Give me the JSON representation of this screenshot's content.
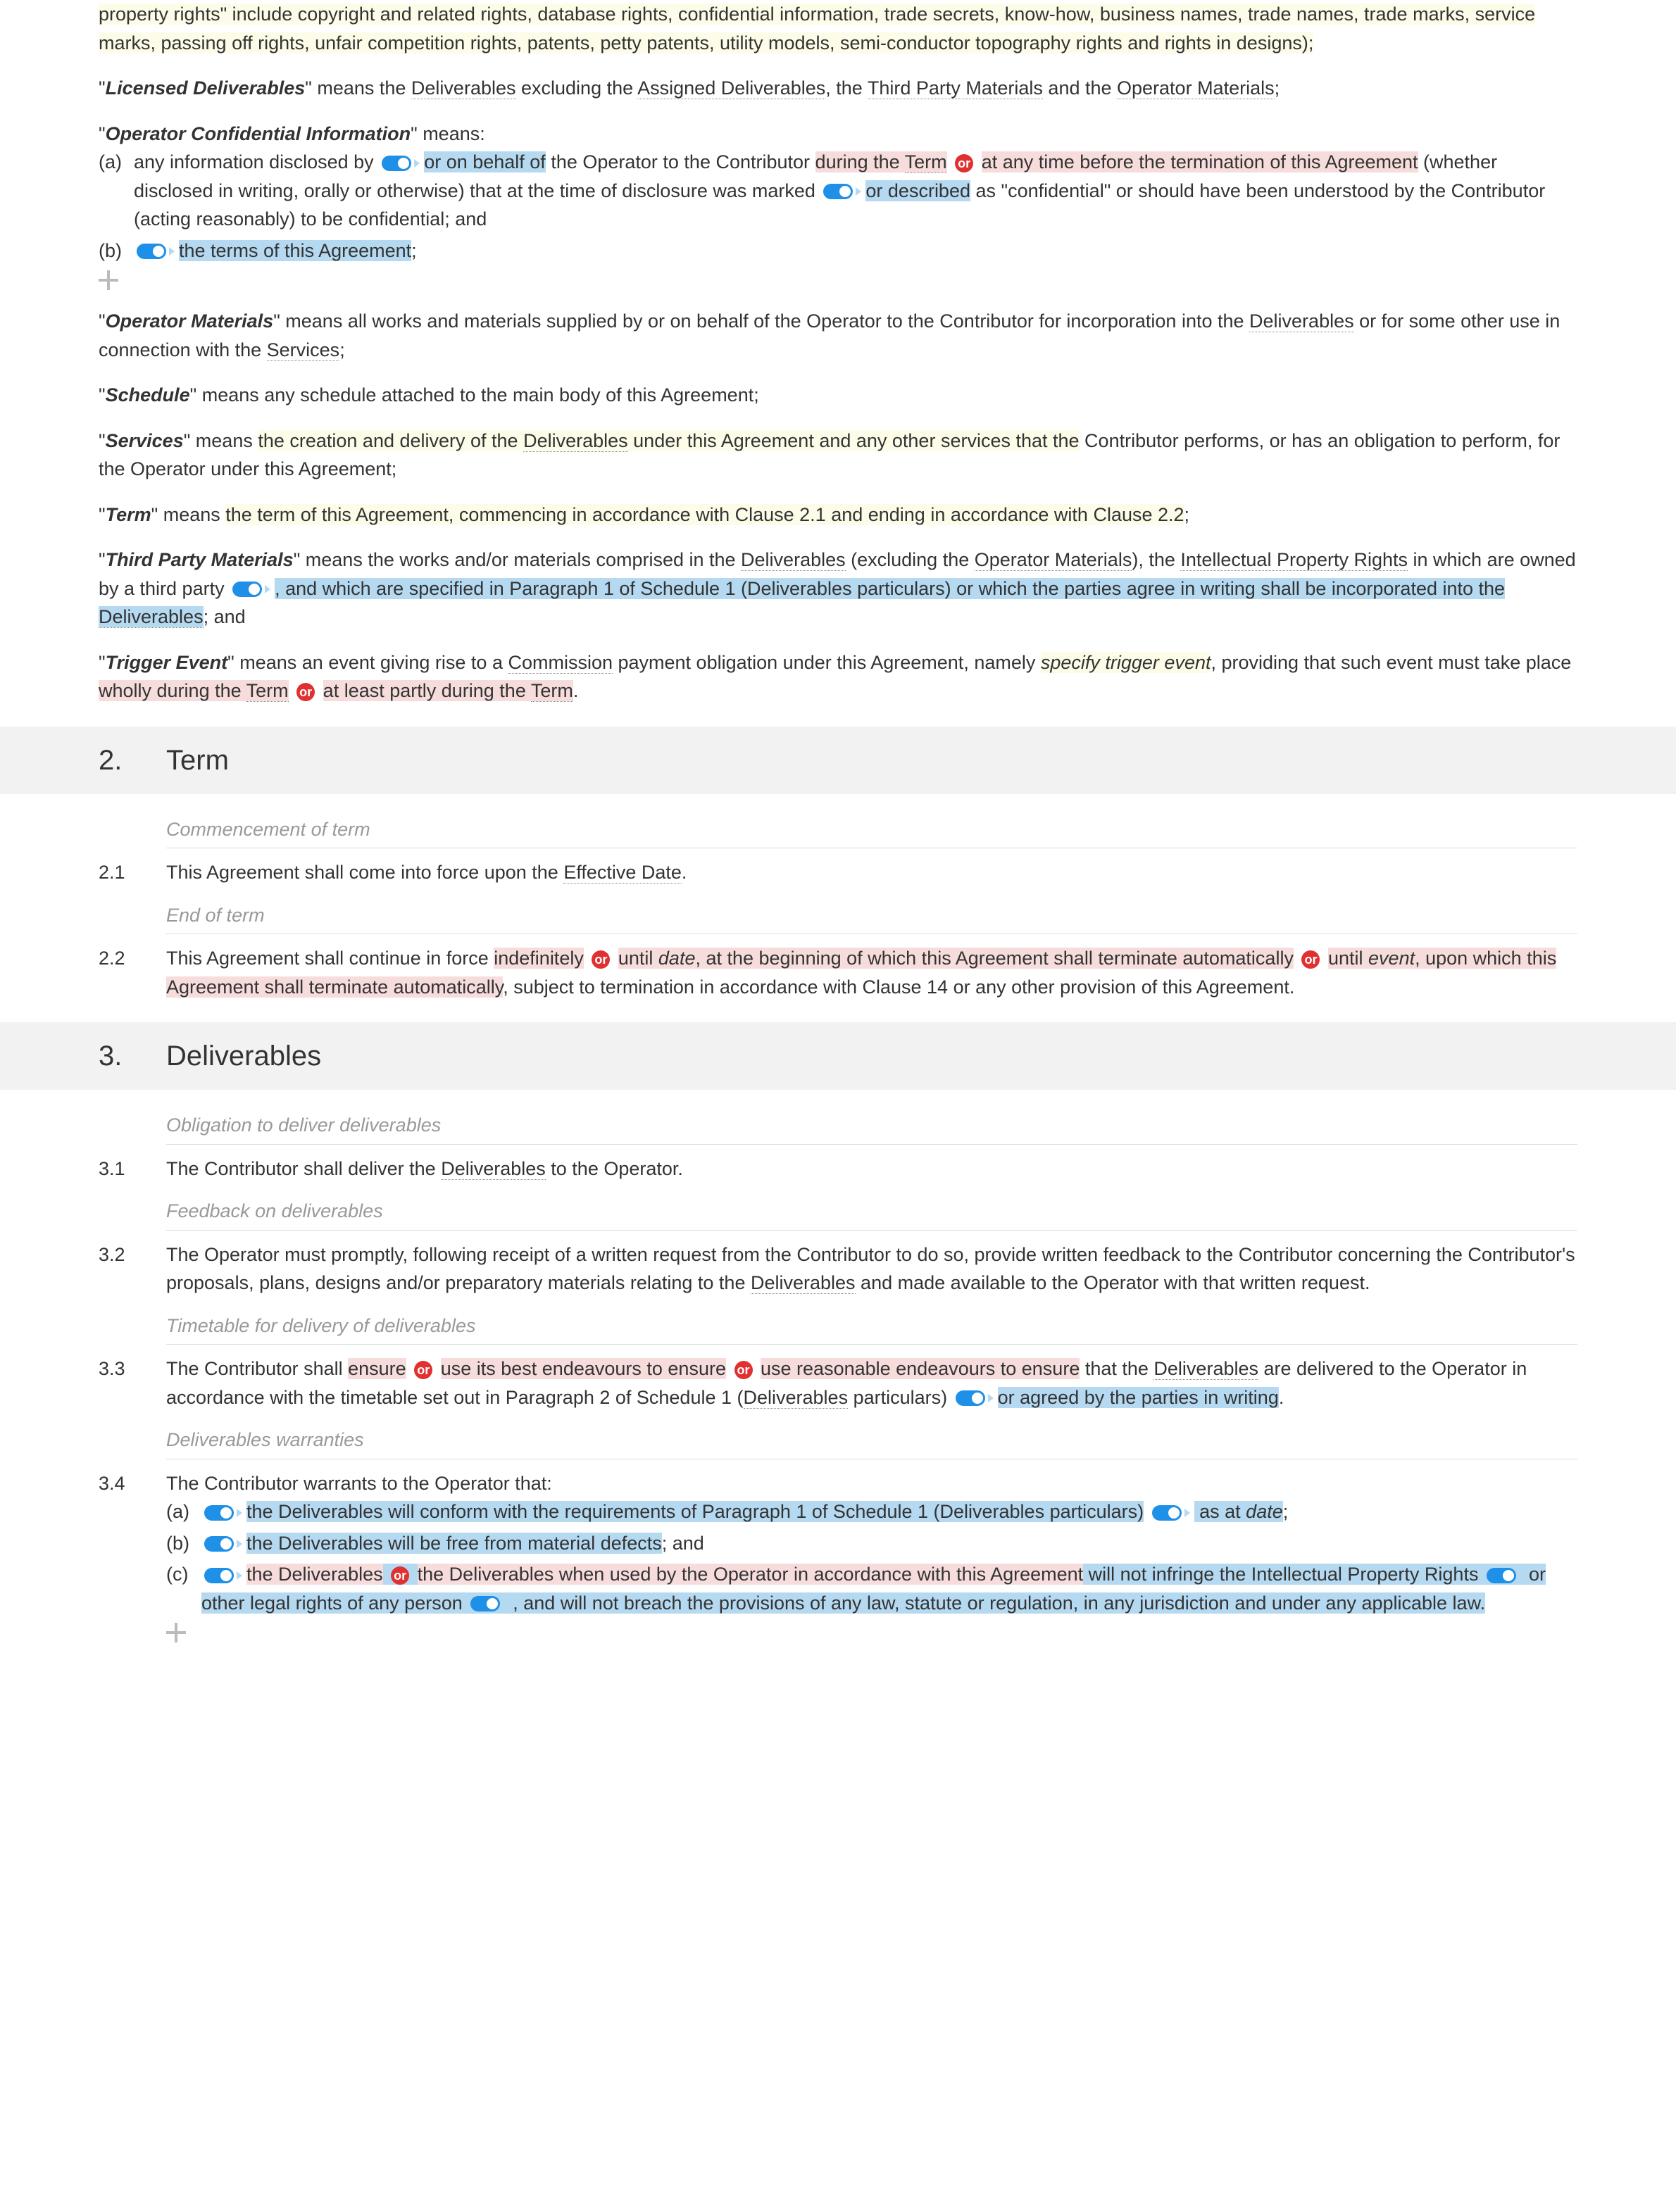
{
  "intro_fragment": "property rights\" include copyright and related rights, database rights, confidential information, trade secrets, know-how, business names, trade names, trade marks, service marks, passing off rights, unfair competition rights, patents, petty patents, utility models, semi-conductor topography rights and rights in designs);",
  "defs": {
    "licensed": {
      "term": "Licensed Deliverables",
      "t1": "\" means the ",
      "d1": "Deliverables",
      "t2": " excluding the ",
      "d2": "Assigned Deliverables",
      "t3": ", the ",
      "d3": "Third Party Materials",
      "t4": " and the ",
      "d4": "Operator Materials",
      "t5": ";"
    },
    "oci": {
      "term": "Operator Confidential Information",
      "means": "\" means:",
      "a_label": "(a)",
      "a1": "any information disclosed by ",
      "a2": "or on behalf of",
      "a3": " the Operator to the Contributor ",
      "a4": "during the ",
      "a4d": "Term",
      "or": "or",
      "a5": "at any time before the termination of this Agreement",
      "a6": " (whether disclosed in writing, orally or otherwise) that at the time of disclosure was marked ",
      "a7": "or described",
      "a8": " as \"confidential\" or should have been understood by the Contributor (acting reasonably) to be confidential; and",
      "b_label": "(b)",
      "b1": "the terms of this Agreement",
      "b2": ";"
    },
    "om": {
      "term": "Operator Materials",
      "t1": "\" means all works and materials supplied by or on behalf of the Operator to the Contributor for incorporation into the ",
      "d1": "Deliverables",
      "t2": " or for some other use in connection with the ",
      "d2": "Services",
      "t3": ";"
    },
    "schedule": {
      "term": "Schedule",
      "body": "\" means any schedule attached to the main body of this Agreement;"
    },
    "services": {
      "term": "Services",
      "t1": "\" means ",
      "t2": "the creation and delivery of the ",
      "d1": "Deliverables",
      "t3": " under this Agreement and any other services that the",
      "t4": " Contributor performs, or has an obligation to perform, for the Operator under this Agreement;"
    },
    "term": {
      "term": "Term",
      "t1": "\" means ",
      "t2": "the term of this Agreement, commencing in accordance with Clause 2.1 and ending in accordance with Clause 2.2",
      "t3": ";"
    },
    "tpm": {
      "term": "Third Party Materials",
      "t1": "\" means the works and/or materials comprised in the ",
      "d1": "Deliverables",
      "t2": " (excluding the ",
      "d2": "Operator Materials",
      "t3": "), the ",
      "d3": "Intellectual Property Rights",
      "t4": " in which are owned by a third party ",
      "t5": ", and which are specified in Paragraph 1 of Schedule 1 (Deliverables particulars) or which the parties agree in writing shall be incorporated into the ",
      "d4": "Deliverables",
      "t6": "; and"
    },
    "trigger": {
      "term": "Trigger Event",
      "t1": "\" means an event giving rise to a ",
      "d1": "Commission",
      "t2": " payment obligation under this Agreement, namely ",
      "var1": "specify trigger event",
      "t3": ", providing that such event must take place ",
      "opt1": "wholly during the ",
      "opt1d": "Term",
      "or": "or",
      "opt2": "at least partly during the ",
      "opt2d": "Term",
      "t4": "."
    }
  },
  "s2": {
    "num": "2.",
    "title": "Term",
    "sub1": "Commencement of term",
    "c21_num": "2.1",
    "c21_t1": "This Agreement shall come into force upon the ",
    "c21_d1": "Effective Date",
    "c21_t2": ".",
    "sub2": "End of term",
    "c22_num": "2.2",
    "c22_t1": "This Agreement shall continue in force ",
    "c22_o1": "indefinitely",
    "or": "or",
    "c22_o2a": "until ",
    "c22_o2v": "date",
    "c22_o2b": ", at the beginning of which this Agreement shall terminate automatically",
    "c22_o3a": "until ",
    "c22_o3v": "event",
    "c22_o3b": ", upon which this Agreement shall terminate automatically",
    "c22_t2": ", subject to termination in accordance with Clause 14 or any other provision of this Agreement."
  },
  "s3": {
    "num": "3.",
    "title": "Deliverables",
    "sub1": "Obligation to deliver deliverables",
    "c31_num": "3.1",
    "c31_t1": "The Contributor shall deliver the ",
    "c31_d1": "Deliverables",
    "c31_t2": " to the Operator.",
    "sub2": "Feedback on deliverables",
    "c32_num": "3.2",
    "c32_t1": "The Operator must promptly, following receipt of a written request from the Contributor to do so, provide written feedback to the Contributor concerning the Contributor's proposals, plans, designs and/or preparatory materials relating to the ",
    "c32_d1": "Deliverables",
    "c32_t2": " and made available to the Operator with that written request.",
    "sub3": "Timetable for delivery of deliverables",
    "c33_num": "3.3",
    "c33_t1": "The Contributor shall ",
    "c33_o1": "ensure",
    "or": "or",
    "c33_o2": "use its best endeavours to ensure",
    "c33_o3": "use reasonable endeavours to ensure",
    "c33_t2": " that the ",
    "c33_d1": "Deliverables",
    "c33_t3": " are delivered to the Operator in accordance with the timetable set out in Paragraph 2 of Schedule 1 (",
    "c33_d2": "Deliverables",
    "c33_t4": " particulars) ",
    "c33_o4": "or agreed by the parties in writing",
    "c33_t5": ".",
    "sub4": "Deliverables warranties",
    "c34_num": "3.4",
    "c34_intro": "The Contributor warrants to the Operator that:",
    "c34a_label": "(a)",
    "c34a_t1": "the Deliverables will conform with the requirements of Paragraph 1 of Schedule 1 (Deliverables particulars)",
    "c34a_t2": " as at ",
    "c34a_v": "date",
    "c34a_t3": ";",
    "c34b_label": "(b)",
    "c34b_t1": "the Deliverables will be free from material defects",
    "c34b_t2": "; and",
    "c34c_label": "(c)",
    "c34c_o1": "the Deliverables",
    "c34c_o2": "the Deliverables when used by the Operator in accordance with this Agreement",
    "c34c_t1": " will not infringe the Intellectual Property Rights ",
    "c34c_t2": "or other legal rights",
    "c34c_t3": " of any person ",
    "c34c_t4": ", and will not breach the provisions of any law, statute or regulation,",
    "c34c_t5": " in any jurisdiction and under any applicable law."
  }
}
